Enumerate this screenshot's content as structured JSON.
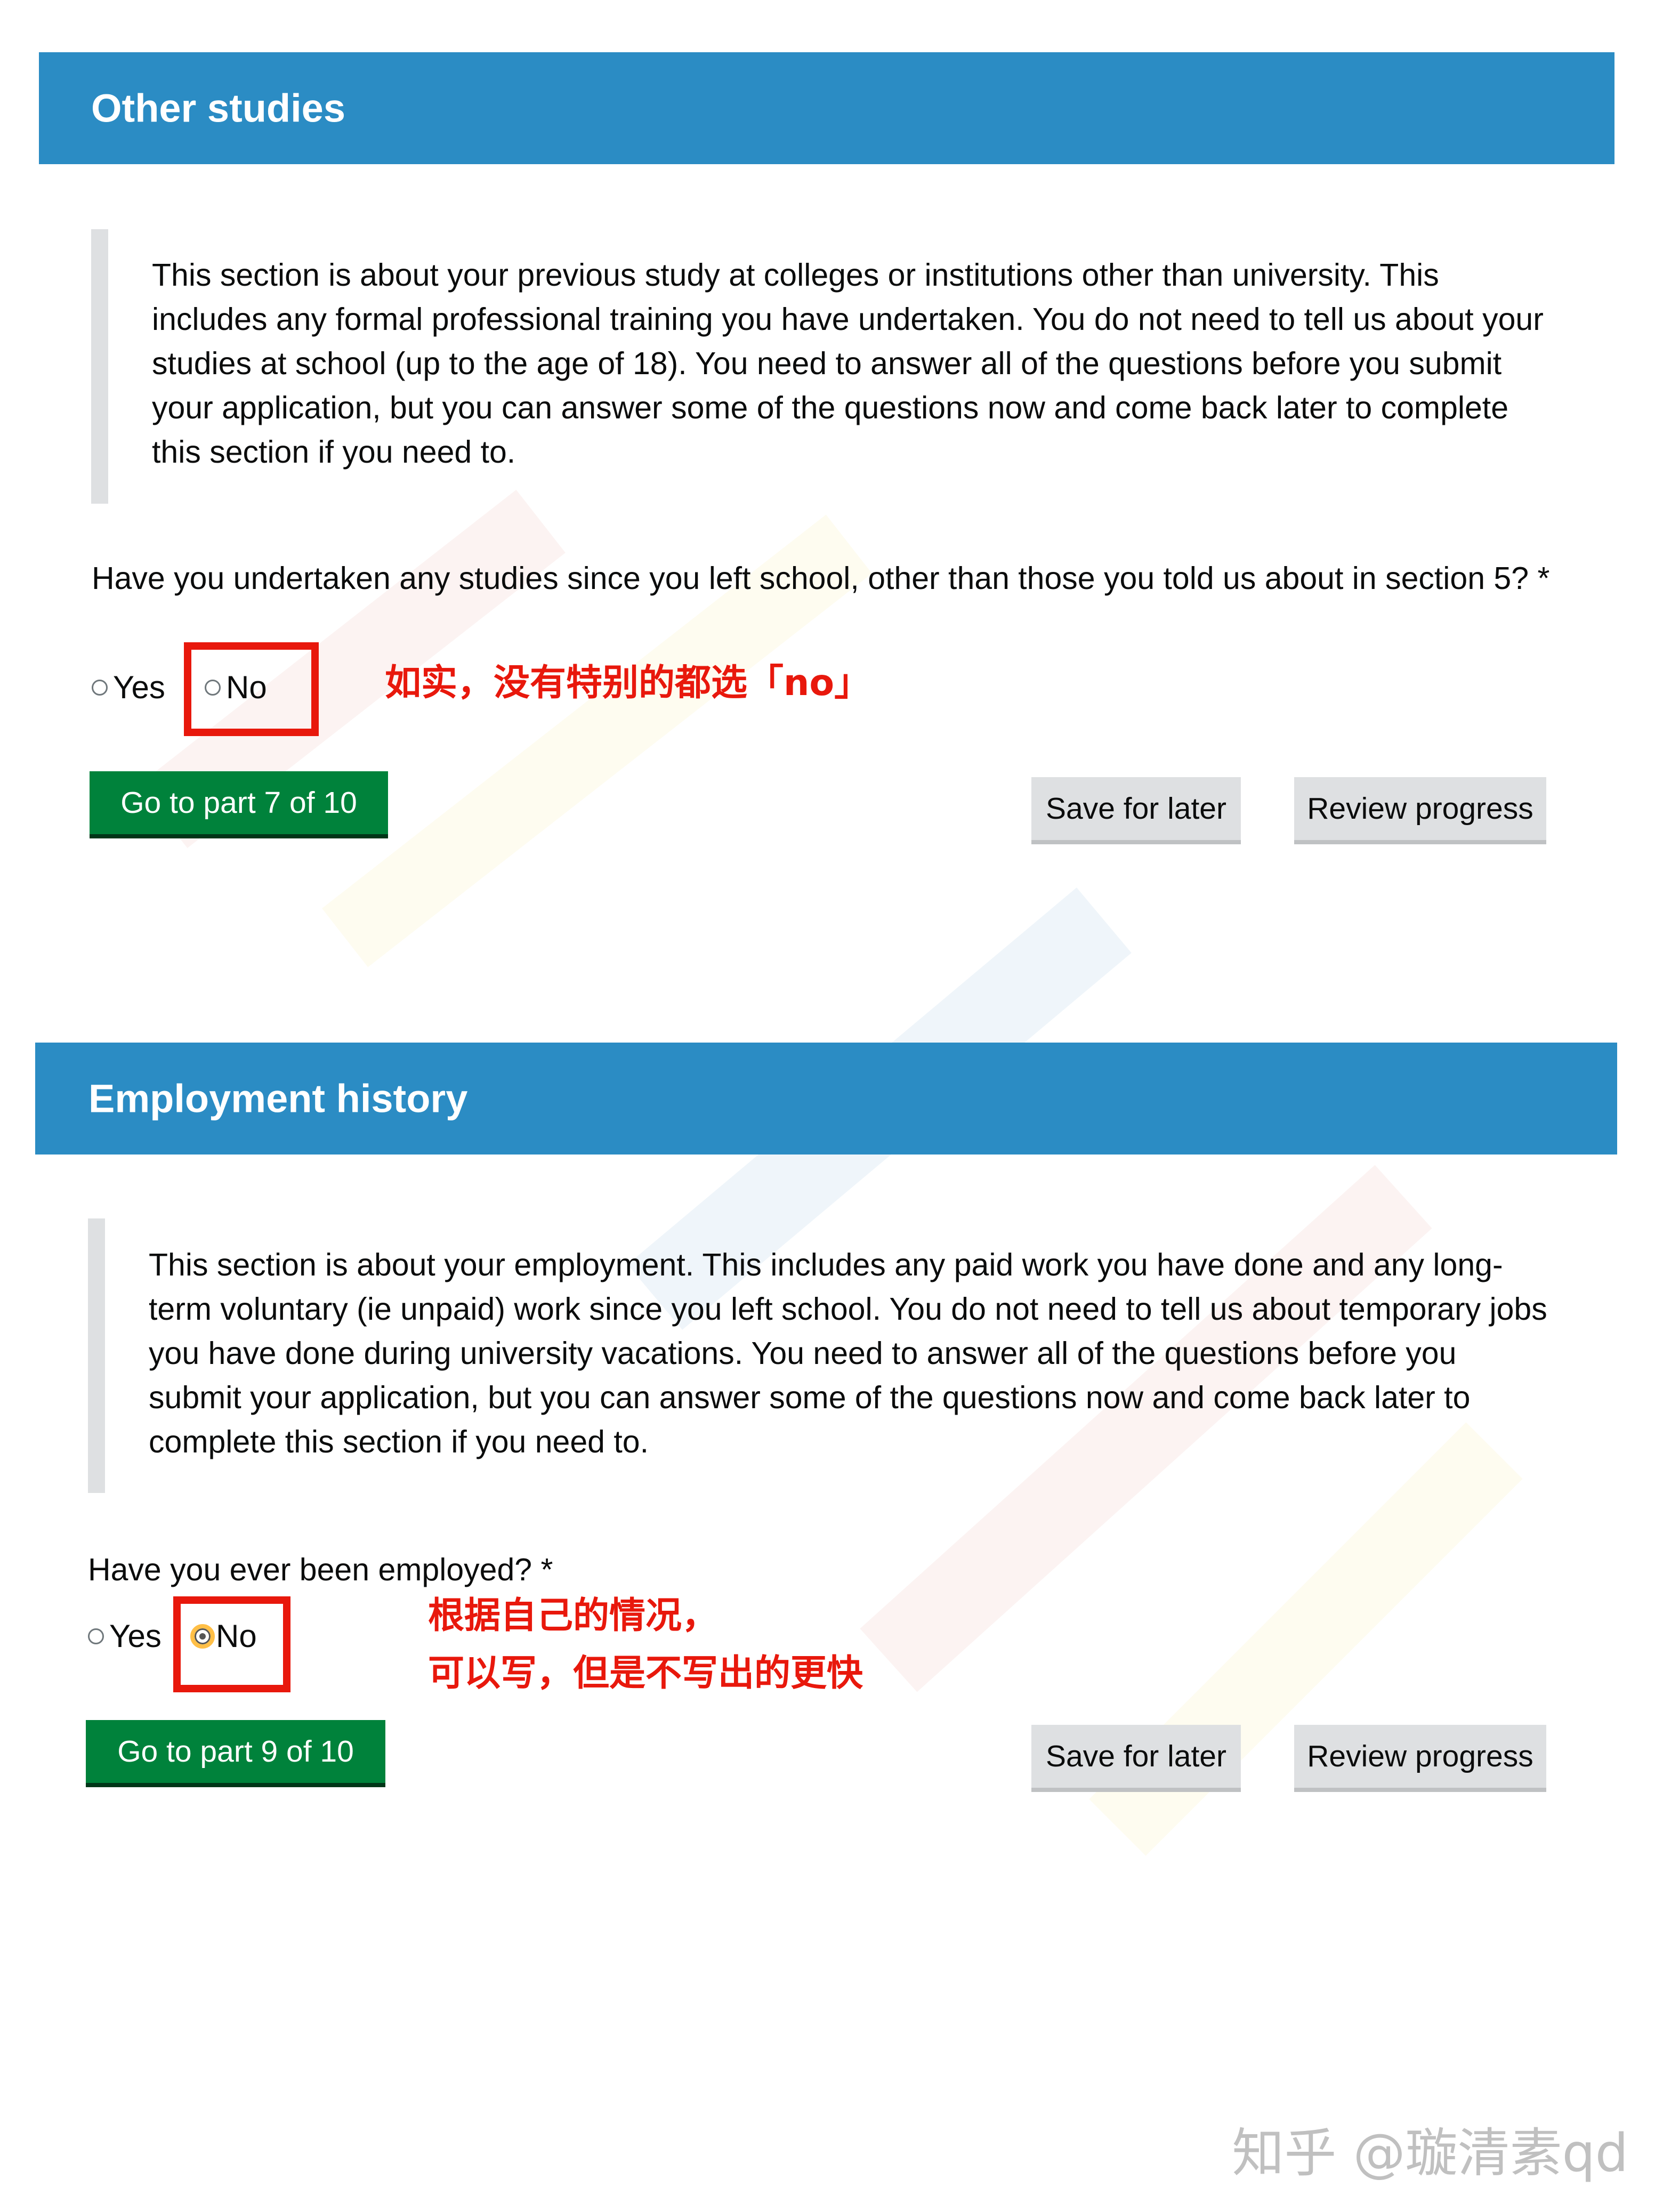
{
  "sections": [
    {
      "title": "Other studies",
      "intro": "This section is about your previous study at colleges or institutions other than university. This includes any formal professional training you have undertaken. You do not need to tell us about your studies at school (up to the age of 18). You need to answer all of the questions before you submit your application, but you can answer some of the questions now and come back later to complete this section if you need to.",
      "question": "Have you undertaken any studies since you left school, other than those you told us about in section 5? *",
      "options": [
        "Yes",
        "No"
      ],
      "selected": null,
      "primary_button": "Go to part 7 of 10",
      "save_button": "Save for later",
      "review_button": "Review progress",
      "annotation": [
        "如实，没有特别的都选「no」"
      ]
    },
    {
      "title": "Employment history",
      "intro": "This section is about your employment. This includes any paid work you have done and any long-term voluntary (ie unpaid) work since you left school. You do not need to tell us about temporary jobs you have done during university vacations. You need to answer all of the questions before you submit your application, but you can answer some of the questions now and come back later to complete this section if you need to.",
      "question": "Have you ever been employed? *",
      "options": [
        "Yes",
        "No"
      ],
      "selected": "No",
      "primary_button": "Go to part 9 of 10",
      "save_button": "Save for later",
      "review_button": "Review progress",
      "annotation": [
        "根据自己的情况，",
        "可以写，但是不写出的更快"
      ]
    }
  ],
  "watermark": "知乎 @璇清素qd",
  "colors": {
    "banner": "#2b8cc4",
    "primary_button": "#00823b",
    "secondary_button": "#dee0e2",
    "annotation_red": "#e8180c",
    "inset_border": "#dee0e2"
  }
}
